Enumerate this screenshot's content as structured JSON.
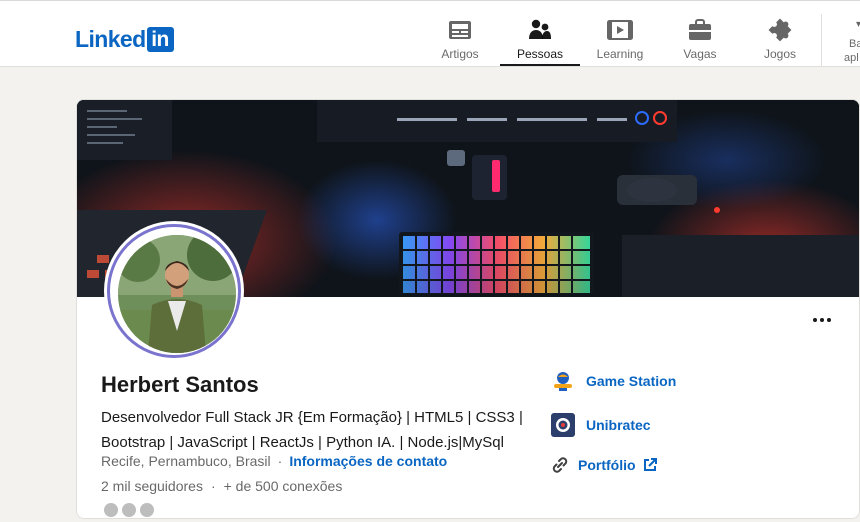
{
  "header": {
    "logo_word": "Linked",
    "logo_box": "in",
    "nav": [
      {
        "label": "Artigos",
        "icon": "articles-icon",
        "active": false
      },
      {
        "label": "Pessoas",
        "icon": "people-icon",
        "active": true
      },
      {
        "label": "Learning",
        "icon": "learning-icon",
        "active": false
      },
      {
        "label": "Vagas",
        "icon": "jobs-icon",
        "active": false
      },
      {
        "label": "Jogos",
        "icon": "games-icon",
        "active": false
      }
    ],
    "more_line1": "Ba",
    "more_line2": "apl"
  },
  "profile": {
    "name": "Herbert Santos",
    "headline": "Desenvolvedor Full Stack JR {Em Formação} | HTML5 | CSS3 | Bootstrap | JavaScript | ReactJs | Python IA. | Node.js|MySql",
    "location": "Recife, Pernambuco, Brasil",
    "location_sep": "·",
    "contact_link": "Informações de contato",
    "followers": "2 mil seguidores",
    "stats_sep": "·",
    "connections": "+ de 500 conexões"
  },
  "aside": {
    "company": "Game Station",
    "school": "Unibratec",
    "website": "Portfólio"
  },
  "colors": {
    "brand": "#0a66c2",
    "ring": "#7a74cf",
    "background": "#f4f2ee"
  }
}
